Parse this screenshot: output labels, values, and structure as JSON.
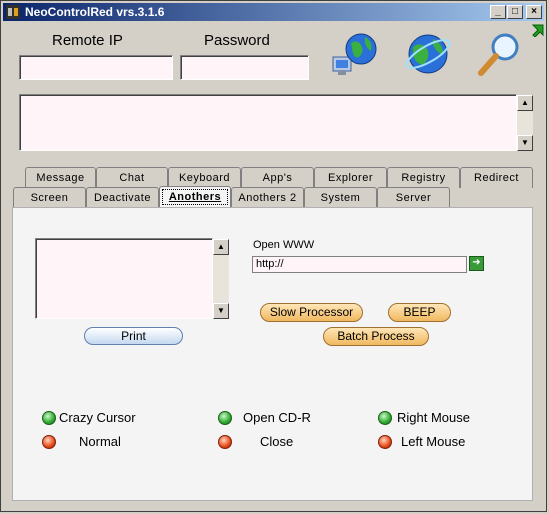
{
  "window": {
    "title": "NeoControlRed vrs.3.1.6"
  },
  "titlebar_buttons": {
    "minimize": "_",
    "maximize": "□",
    "close": "×"
  },
  "connection": {
    "remote_ip_label": "Remote IP",
    "password_label": "Password",
    "remote_ip_value": "",
    "password_value": ""
  },
  "icons": {
    "connect": "network-globe-icon",
    "internet": "internet-globe-icon",
    "search": "magnifier-icon",
    "cursor": "green-cursor-icon"
  },
  "tabs_row1": [
    "Message",
    "Chat",
    "Keyboard",
    "App's",
    "Explorer",
    "Registry",
    "Redirect"
  ],
  "tabs_row2": [
    "Screen",
    "Deactivate",
    "Anothers",
    "Anothers 2",
    "System",
    "Server"
  ],
  "active_tab": "Anothers",
  "anothers": {
    "print_label": "Print",
    "open_www_label": "Open WWW",
    "url_value": "http://",
    "slow_processor_label": "Slow Processor",
    "beep_label": "BEEP",
    "batch_process_label": "Batch Process",
    "options": [
      {
        "label": "Crazy Cursor",
        "state": "green"
      },
      {
        "label": "Normal",
        "state": "red"
      },
      {
        "label": "Open CD-R",
        "state": "green"
      },
      {
        "label": "Close",
        "state": "red"
      },
      {
        "label": "Right Mouse",
        "state": "green"
      },
      {
        "label": "Left Mouse",
        "state": "red"
      }
    ]
  },
  "colors": {
    "titlebar_start": "#0a246a",
    "field_bg": "#fff5f8",
    "led_green": "#2ea82e",
    "led_red": "#e84818"
  }
}
